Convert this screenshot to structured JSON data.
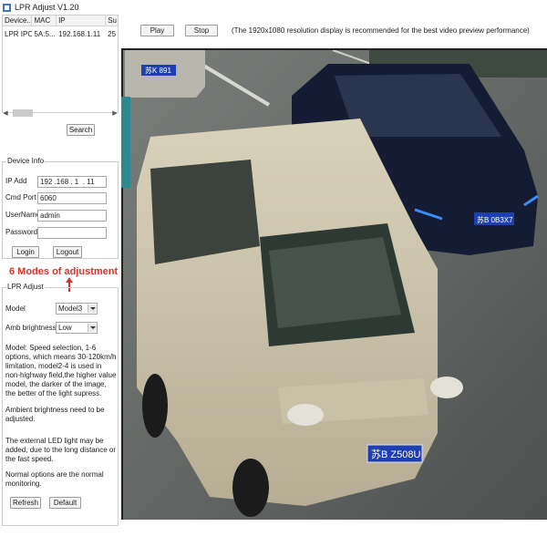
{
  "window": {
    "title": "LPR Adjust V1.20"
  },
  "device_list": {
    "columns": [
      "Device...",
      "MAC",
      "IP",
      "Su"
    ],
    "rows": [
      {
        "device": "LPR IPC",
        "mac": "5A:5...",
        "ip": "192.168.1.11",
        "status": "25"
      }
    ],
    "search_label": "Search"
  },
  "device_info": {
    "title": "Device Info",
    "ip_label": "IP Add",
    "ip_value": "192 .168 . 1  . 11",
    "port_label": "Cmd Port",
    "port_value": "6060",
    "username_label": "UserName",
    "username_value": "admin",
    "password_label": "Password",
    "password_value": "",
    "login_label": "Login",
    "logout_label": "Logout"
  },
  "annotation": {
    "text": "6 Modes of adjustment",
    "color": "#d6342a"
  },
  "lpr_adjust": {
    "title": "LPR Adjust",
    "model_label": "Model",
    "model_value": "Model3",
    "amb_label": "Amb brightness",
    "amb_value": "Low",
    "info_1": "Model: Speed selection, 1-6 options, which means 30-120km/h limitation, model2-4 is used in non-highway field,the higher value model, the darker of the image, the better of the light supress.",
    "info_2": "Ambient brightness need to be adjusted.",
    "info_3": "The external LED light may be added, due to the long distance or the fast speed.",
    "info_4": "Normal options are the normal monitoring.",
    "refresh_label": "Refresh",
    "default_label": "Default"
  },
  "toolbar": {
    "play_label": "Play",
    "stop_label": "Stop",
    "note": "(The 1920x1080 resolution display is recommended for the best video preview performance)"
  },
  "video": {
    "plate_main": "苏B Z508U",
    "plate_right": "苏B 0B3X7",
    "plate_topleft": "苏K 891"
  },
  "colors": {
    "accent": "#d6342a",
    "plate_blue": "#1f3fb0"
  }
}
